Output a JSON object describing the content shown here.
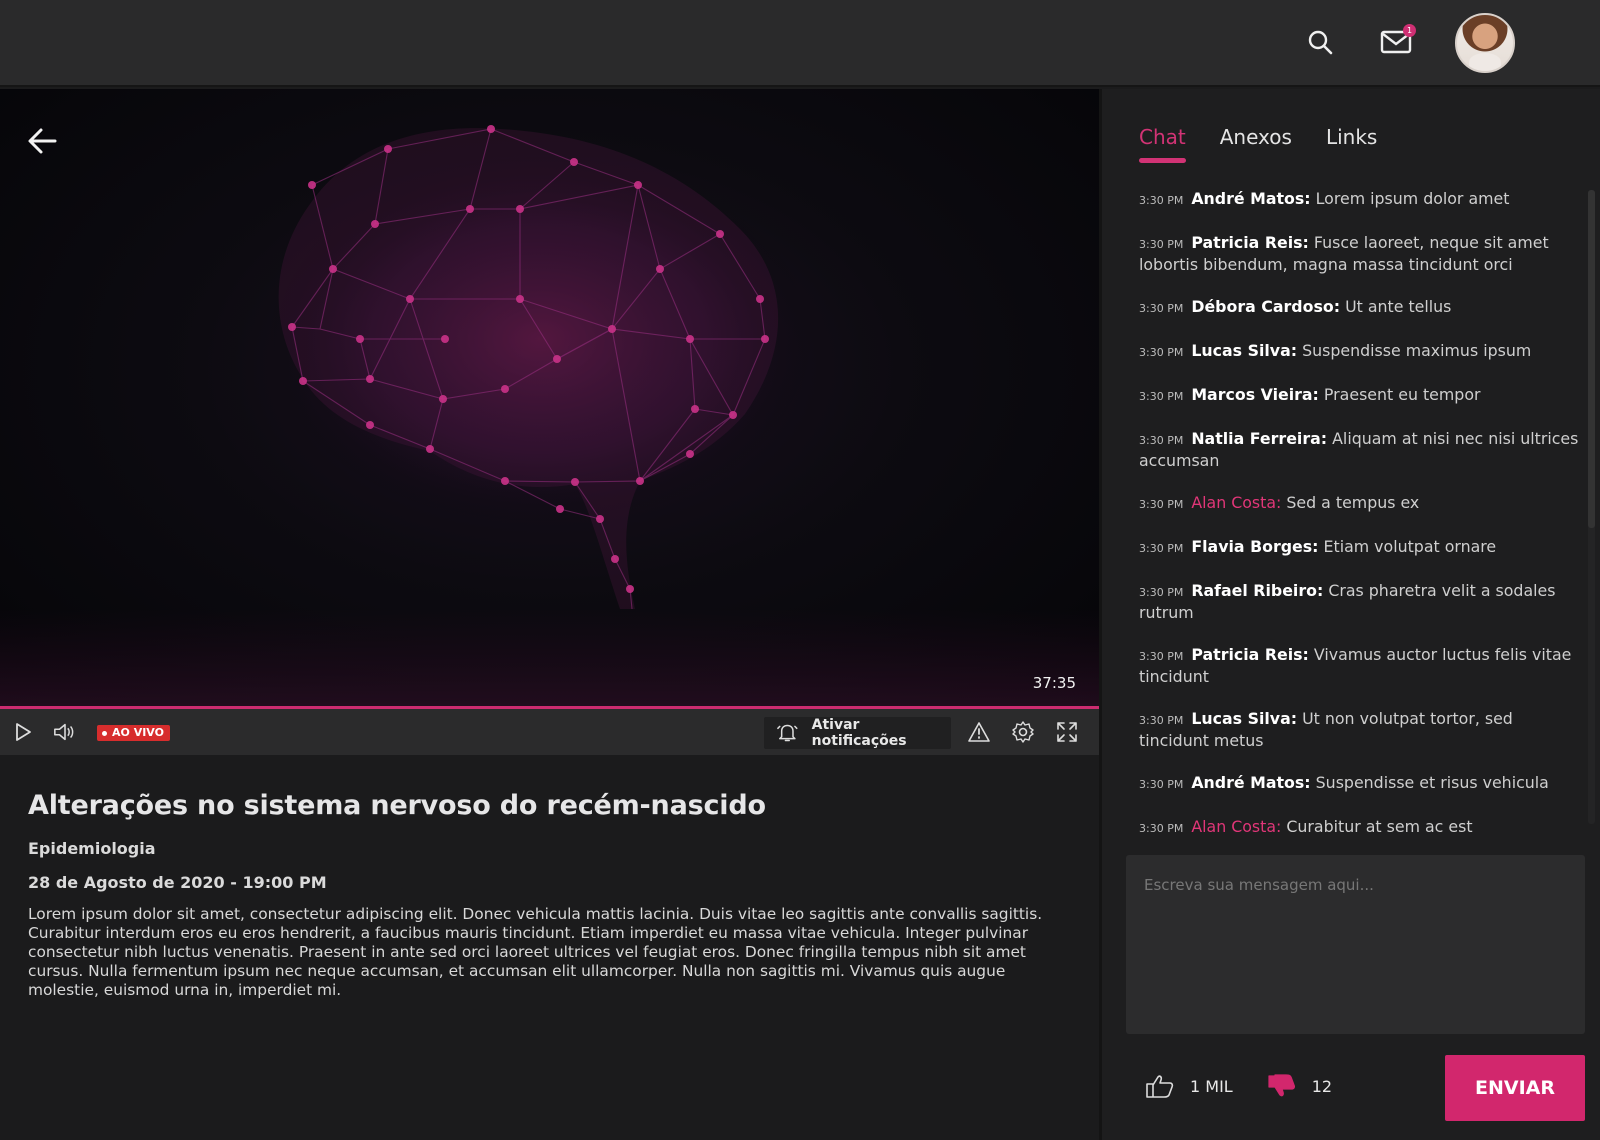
{
  "header": {
    "search_icon": "search-icon",
    "mail_icon": "mail-icon",
    "mail_badge": "1"
  },
  "video": {
    "timecode": "37:35",
    "live_label": "AO VIVO",
    "notify_label": "Ativar notificações",
    "progress_fraction": 1.0
  },
  "lesson": {
    "title": "Alterações no sistema nervoso do recém-nascido",
    "subject": "Epidemiologia",
    "date": "28 de Agosto de 2020 - 19:00 PM",
    "description": "Lorem ipsum dolor sit amet, consectetur adipiscing elit. Donec vehicula mattis lacinia. Duis vitae leo sagittis ante convallis sagittis. Curabitur interdum eros eu eros hendrerit, a faucibus mauris tincidunt. Etiam imperdiet eu massa vitae vehicula. Integer pulvinar consectetur nibh luctus venenatis. Praesent in ante sed orci laoreet ultrices vel feugiat eros. Donec fringilla tempus nibh sit amet cursus. Nulla fermentum ipsum nec neque accumsan, et accumsan elit ullamcorper. Nulla non sagittis mi. Vivamus quis augue molestie, euismod urna in, imperdiet mi."
  },
  "sidebar": {
    "tabs": [
      {
        "label": "Chat"
      },
      {
        "label": "Anexos"
      },
      {
        "label": "Links"
      }
    ],
    "messages": [
      {
        "time": "3:30 PM",
        "name": "André Matos:",
        "text": "Lorem ipsum dolor amet"
      },
      {
        "time": "3:30 PM",
        "name": "Patricia Reis:",
        "text": "Fusce laoreet, neque sit amet lobortis bibendum, magna massa tincidunt orci"
      },
      {
        "time": "3:30 PM",
        "name": "Débora Cardoso:",
        "text": "Ut ante tellus"
      },
      {
        "time": "3:30 PM",
        "name": "Lucas Silva:",
        "text": "Suspendisse maximus ipsum"
      },
      {
        "time": "3:30 PM",
        "name": "Marcos Vieira:",
        "text": "Praesent eu tempor"
      },
      {
        "time": "3:30 PM",
        "name": "Natlia Ferreira:",
        "text": "Aliquam at nisi nec nisi ultrices accumsan"
      },
      {
        "time": "3:30 PM",
        "name": "Alan Costa:",
        "text": "Sed a tempus ex"
      },
      {
        "time": "3:30 PM",
        "name": "Flavia Borges:",
        "text": "Etiam volutpat ornare"
      },
      {
        "time": "3:30 PM",
        "name": "Rafael Ribeiro:",
        "text": "Cras pharetra velit a sodales rutrum"
      },
      {
        "time": "3:30 PM",
        "name": "Patricia Reis:",
        "text": "Vivamus auctor luctus felis vitae tincidunt"
      },
      {
        "time": "3:30 PM",
        "name": "Lucas Silva:",
        "text": "Ut non volutpat tortor, sed tincidunt metus"
      },
      {
        "time": "3:30 PM",
        "name": "André Matos:",
        "text": "Suspendisse et risus vehicula"
      },
      {
        "time": "3:30 PM",
        "name": "Alan Costa:",
        "text": "Curabitur at sem ac est"
      }
    ],
    "input_placeholder": "Escreva sua mensagem aqui...",
    "likes": "1 MIL",
    "dislikes": "12",
    "send_label": "ENVIAR"
  },
  "colors": {
    "accent": "#D2276D",
    "live": "#D72D2D"
  }
}
